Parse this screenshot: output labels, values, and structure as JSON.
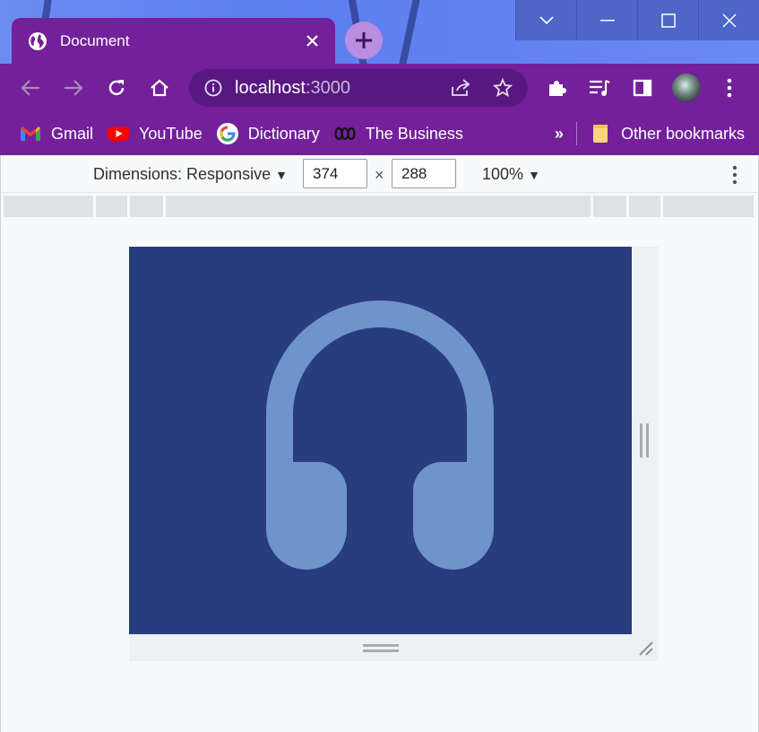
{
  "window": {
    "controls": [
      "chevron-down",
      "minimize",
      "maximize",
      "close"
    ]
  },
  "tab": {
    "title": "Document",
    "icon": "globe-icon"
  },
  "toolbar": {
    "url_host": "localhost",
    "url_port": ":3000",
    "icons": [
      "back-icon",
      "forward-icon",
      "reload-icon",
      "home-icon",
      "info-icon",
      "share-icon",
      "star-icon",
      "extensions-icon",
      "media-queue-icon",
      "side-panel-icon",
      "avatar",
      "menu-icon"
    ]
  },
  "bookmarks": {
    "items": [
      {
        "label": "Gmail",
        "icon": "gmail-icon"
      },
      {
        "label": "YouTube",
        "icon": "youtube-icon"
      },
      {
        "label": "Dictionary",
        "icon": "google-icon"
      },
      {
        "label": "The Business",
        "icon": "abc-icon"
      }
    ],
    "overflow": "»",
    "other": "Other bookmarks"
  },
  "devtools": {
    "dimensions_label": "Dimensions: Responsive",
    "width": "374",
    "height": "288",
    "times": "×",
    "zoom": "100%"
  },
  "viewport": {
    "background": "#293c7e",
    "icon": "headphones-icon",
    "icon_color": "#6f93cb"
  }
}
